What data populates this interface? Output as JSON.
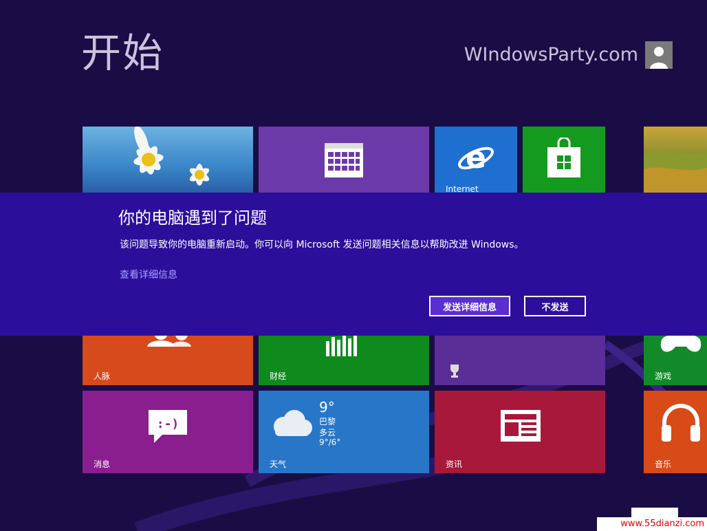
{
  "start": {
    "title": "开始"
  },
  "user": {
    "name": "WIndowsParty.com"
  },
  "tiles": {
    "internet": {
      "label": "Internet"
    },
    "people": {
      "label": "人脉"
    },
    "finance": {
      "label": "财经"
    },
    "games": {
      "label": "游戏"
    },
    "messaging": {
      "label": "消息"
    },
    "weather": {
      "label": "天气",
      "temperature": "9°",
      "city": "巴黎",
      "condition": "多云",
      "range": "9°/6°"
    },
    "news": {
      "label": "资讯"
    },
    "music": {
      "label": "音乐"
    }
  },
  "dialog": {
    "title": "你的电脑遇到了问题",
    "message": "该问题导致你的电脑重新启动。你可以向 Microsoft 发送问题相关信息以帮助改进 Windows。",
    "details_link": "查看详细信息",
    "send_button": "发送详细信息",
    "dont_send_button": "不发送"
  },
  "watermark": {
    "text": "www.55dianzi.com"
  },
  "colors": {
    "background": "#1a0d45",
    "dialog": "#2b0f9a",
    "link": "#a9a0ff",
    "send_button": "#5a2ed0"
  }
}
